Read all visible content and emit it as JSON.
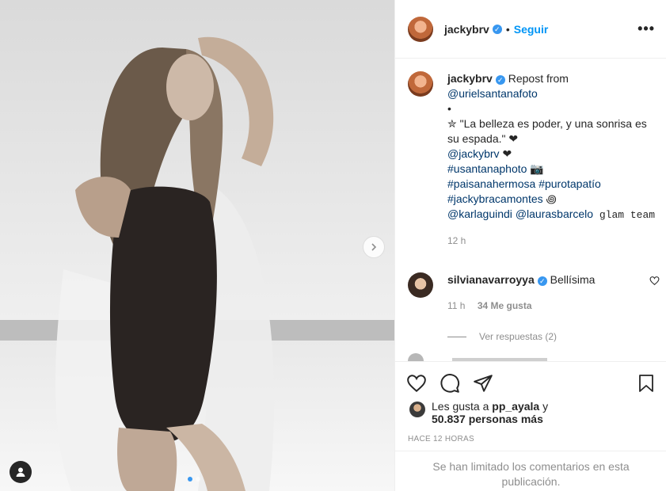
{
  "post": {
    "author": "jackybrv",
    "follow_label": "Seguir",
    "separator": "•",
    "more_label": "•••"
  },
  "caption": {
    "username": "jackybrv",
    "repost_label": "Repost from",
    "repost_handle": "@urielsantanafoto",
    "dot": "•",
    "quote": "✮ \"La belleza es poder, y una sonrisa es su espada.\" ❤",
    "mention1": "@jackybrv",
    "mention1_suffix": " ❤",
    "tag1": "#usantanaphoto",
    "tag1_suffix": " 📷",
    "tag2": "#paisanahermosa",
    "tag3": "#purotapatío",
    "tag4": "#jackybracamontes",
    "tag4_suffix": " ꩜",
    "mention2": "@karlaguindi",
    "mention3": "@laurasbarcelo",
    "mono_text": " glam team",
    "time": "12 h"
  },
  "comment": {
    "username": "silvianavarroyya",
    "text": "Bellísima",
    "time": "11 h",
    "likes": "34 Me gusta",
    "replies": "Ver respuestas (2)"
  },
  "likes": {
    "prefix": "Les gusta a",
    "user": "pp_ayala",
    "joiner": "y",
    "count": "50.837 personas más"
  },
  "timestamp": "HACE 12 HORAS",
  "limited_notice": "Se han limitado los comentarios en esta publicación.",
  "icons": {
    "like": "heart-icon",
    "comment": "comment-icon",
    "share": "paper-plane-icon",
    "save": "bookmark-icon",
    "next": "chevron-right-icon",
    "tag": "user-tag-icon"
  },
  "colors": {
    "accent": "#0095f6",
    "verified": "#3897f0",
    "muted": "#8e8e8e",
    "link": "#00376b"
  }
}
